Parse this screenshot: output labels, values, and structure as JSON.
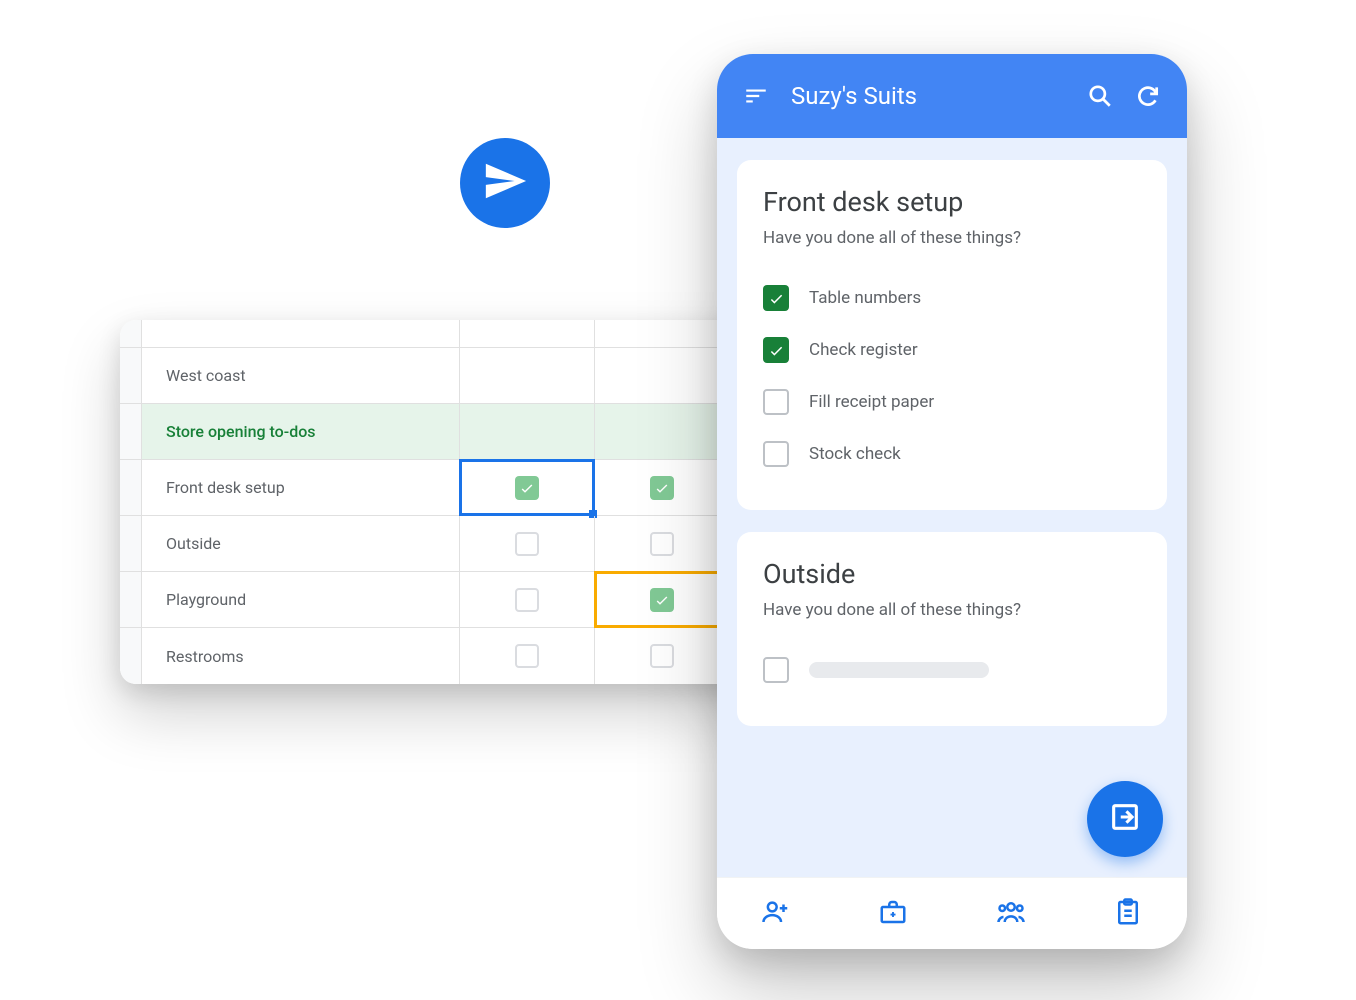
{
  "colors": {
    "blue": "#4285f4",
    "blue_dark": "#1a73e8",
    "green_check": "#188038",
    "green_soft": "#81c995",
    "green_bg": "#e6f4ea",
    "orange": "#f9ab00",
    "text_gray": "#5f6368"
  },
  "sheet": {
    "region_label": "West coast",
    "section_title": "Store opening to-dos",
    "rows": [
      {
        "label": "Front desk setup",
        "c1": "checked",
        "c2": "checked",
        "c1_sel": "blue"
      },
      {
        "label": "Outside",
        "c1": "empty",
        "c2": "empty"
      },
      {
        "label": "Playground",
        "c1": "empty",
        "c2": "checked",
        "c2_sel": "orange"
      },
      {
        "label": "Restrooms",
        "c1": "empty",
        "c2": "empty"
      }
    ]
  },
  "phone": {
    "title": "Suzy's Suits",
    "cards": [
      {
        "title": "Front desk setup",
        "subtitle": "Have you done all of these things?",
        "items": [
          {
            "label": "Table numbers",
            "checked": true
          },
          {
            "label": "Check register",
            "checked": true
          },
          {
            "label": "Fill receipt paper",
            "checked": false
          },
          {
            "label": "Stock check",
            "checked": false
          }
        ]
      },
      {
        "title": "Outside",
        "subtitle": "Have you done all of these things?",
        "items": [
          {
            "label": "",
            "checked": false,
            "skeleton": true
          }
        ]
      }
    ],
    "nav_icons": [
      "person-add-icon",
      "briefcase-icon",
      "group-icon",
      "clipboard-icon"
    ]
  }
}
